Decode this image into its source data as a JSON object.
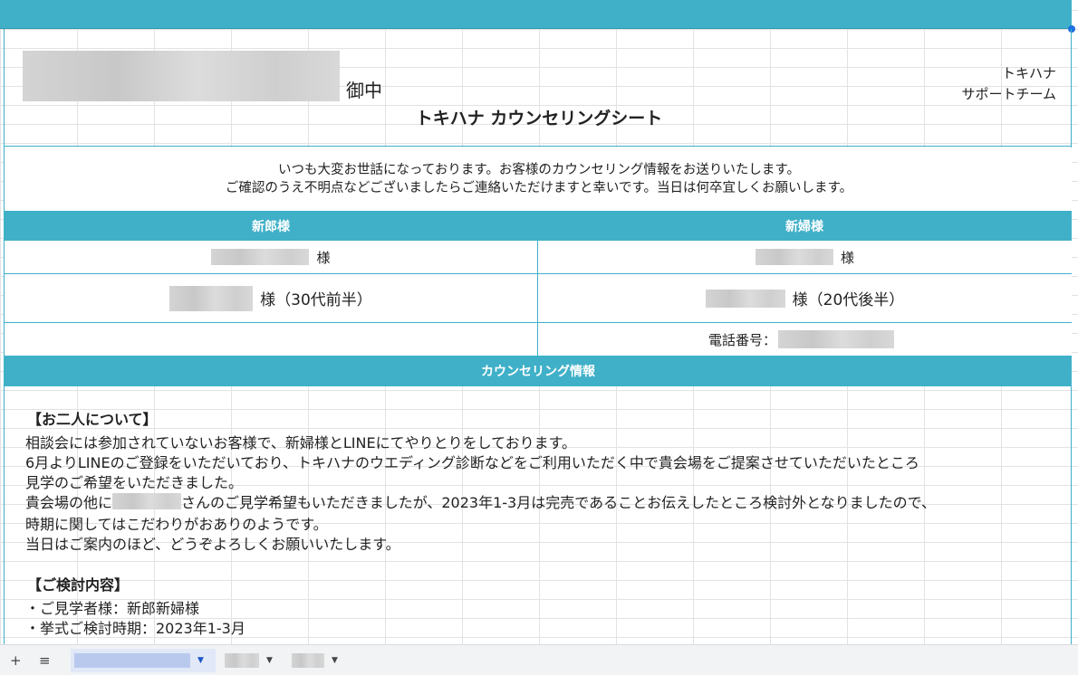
{
  "header": {
    "recipient_suffix": "御中",
    "company_line1": "トキハナ",
    "company_line2": "サポートチーム",
    "title": "トキハナ カウンセリングシート"
  },
  "intro": {
    "line1": "いつも大変お世話になっております。お客様のカウンセリング情報をお送りいたします。",
    "line2": "ご確認のうえ不明点などございましたらご連絡いただけますと幸いです。当日は何卒宜しくお願いします。"
  },
  "couple": {
    "groom_header": "新郎様",
    "bride_header": "新婦様",
    "groom_name_suffix": "様",
    "bride_name_suffix": "様",
    "groom_age": "様（30代前半）",
    "bride_age": "様（20代後半）",
    "phone_label": "電話番号："
  },
  "counseling": {
    "header": "カウンセリング情報",
    "section1_title": "【お二人について】",
    "section1_lines": [
      "相談会には参加されていないお客様で、新婦様とLINEにてやりとりをしております。",
      "6月よりLINEのご登録をいただいており、トキハナのウエディング診断などをご利用いただく中で貴会場をご提案させていただいたところ",
      "見学のご希望をいただきました。",
      "さんのご見学希望もいただきましたが、2023年1-3月は完売であることお伝えしたところ検討外となりましたので、",
      "時期に関してはこだわりがおありのようです。",
      "当日はご案内のほど、どうぞよろしくお願いいたします。"
    ],
    "section1_line4_prefix": "貴会場の他に",
    "section2_title": "【ご検討内容】",
    "section2_lines": [
      "・ご見学者様：新郎新婦様",
      "・挙式ご検討時期：2023年1-3月"
    ]
  },
  "tabbar": {
    "add_sheet": "+",
    "all_sheets": "≡"
  }
}
